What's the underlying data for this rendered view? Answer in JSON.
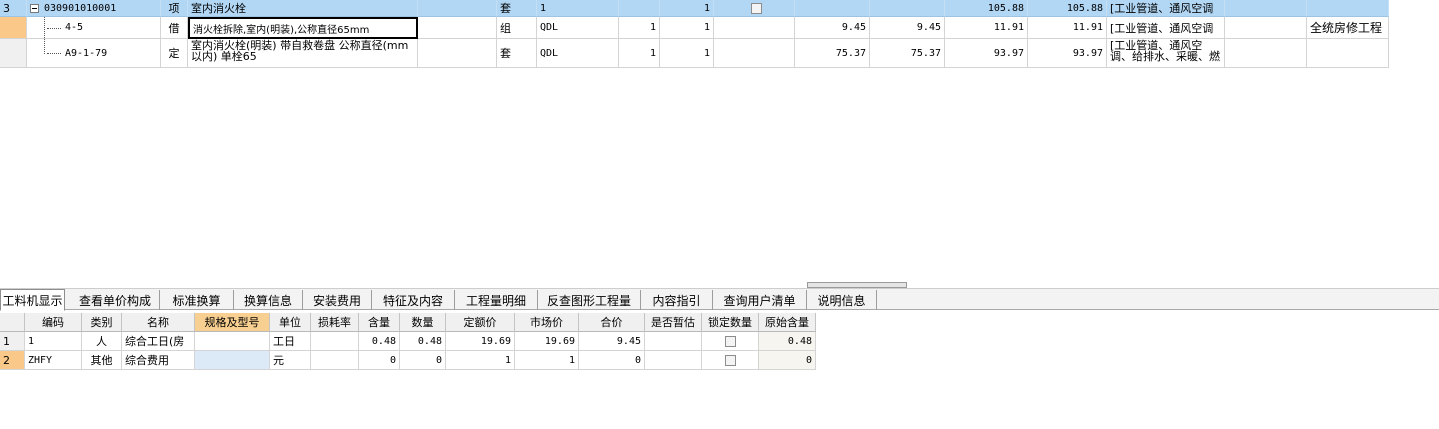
{
  "main_grid": {
    "rows": [
      {
        "num": "3",
        "code": "030901010001",
        "type": "项",
        "name": "室内消火栓",
        "unit": "套",
        "expr": "1",
        "qty": "",
        "q2": "1",
        "unit_price": "",
        "total": "",
        "price2": "105.88",
        "total2": "105.88",
        "specialty": "[工业管道、通风空调",
        "remark": ""
      },
      {
        "num": "",
        "code": "4-5",
        "type": "借",
        "name": "消火栓拆除,室内(明装),公称直径65mm",
        "unit": "组",
        "expr": "QDL",
        "qty": "1",
        "q2": "1",
        "unit_price": "9.45",
        "total": "9.45",
        "price2": "11.91",
        "total2": "11.91",
        "specialty": "[工业管道、通风空调",
        "remark": "全统房修工程"
      },
      {
        "num": "",
        "code": "A9-1-79",
        "type": "定",
        "name": "室内消火栓(明装) 带自救卷盘 公称直径(mm以内) 单栓65",
        "unit": "套",
        "expr": "QDL",
        "qty": "1",
        "q2": "1",
        "unit_price": "75.37",
        "total": "75.37",
        "price2": "93.97",
        "total2": "93.97",
        "specialty": "[工业管道、通风空调、给排水、采暖、燃",
        "remark": ""
      }
    ]
  },
  "tabs": [
    {
      "label": "工料机显示"
    },
    {
      "label": "查看单价构成"
    },
    {
      "label": "标准换算"
    },
    {
      "label": "换算信息"
    },
    {
      "label": "安装费用"
    },
    {
      "label": "特征及内容"
    },
    {
      "label": "工程量明细"
    },
    {
      "label": "反查图形工程量"
    },
    {
      "label": "内容指引"
    },
    {
      "label": "查询用户清单"
    },
    {
      "label": "说明信息"
    }
  ],
  "resource_grid": {
    "headers": [
      "编码",
      "类别",
      "名称",
      "规格及型号",
      "单位",
      "损耗率",
      "含量",
      "数量",
      "定额价",
      "市场价",
      "合价",
      "是否暂估",
      "锁定数量",
      "原始含量"
    ],
    "rows": [
      {
        "num": "1",
        "code": "1",
        "category": "人",
        "name": "综合工日(房",
        "spec": "",
        "unit": "工日",
        "loss": "",
        "content": "0.48",
        "qty": "0.48",
        "quota_price": "19.69",
        "market_price": "19.69",
        "total": "9.45",
        "estimated": "",
        "orig_content": "0.48"
      },
      {
        "num": "2",
        "code": "ZHFY",
        "category": "其他",
        "name": "综合费用",
        "spec": "",
        "unit": "元",
        "loss": "",
        "content": "0",
        "qty": "0",
        "quota_price": "1",
        "market_price": "1",
        "total": "0",
        "estimated": "",
        "orig_content": "0"
      }
    ]
  }
}
